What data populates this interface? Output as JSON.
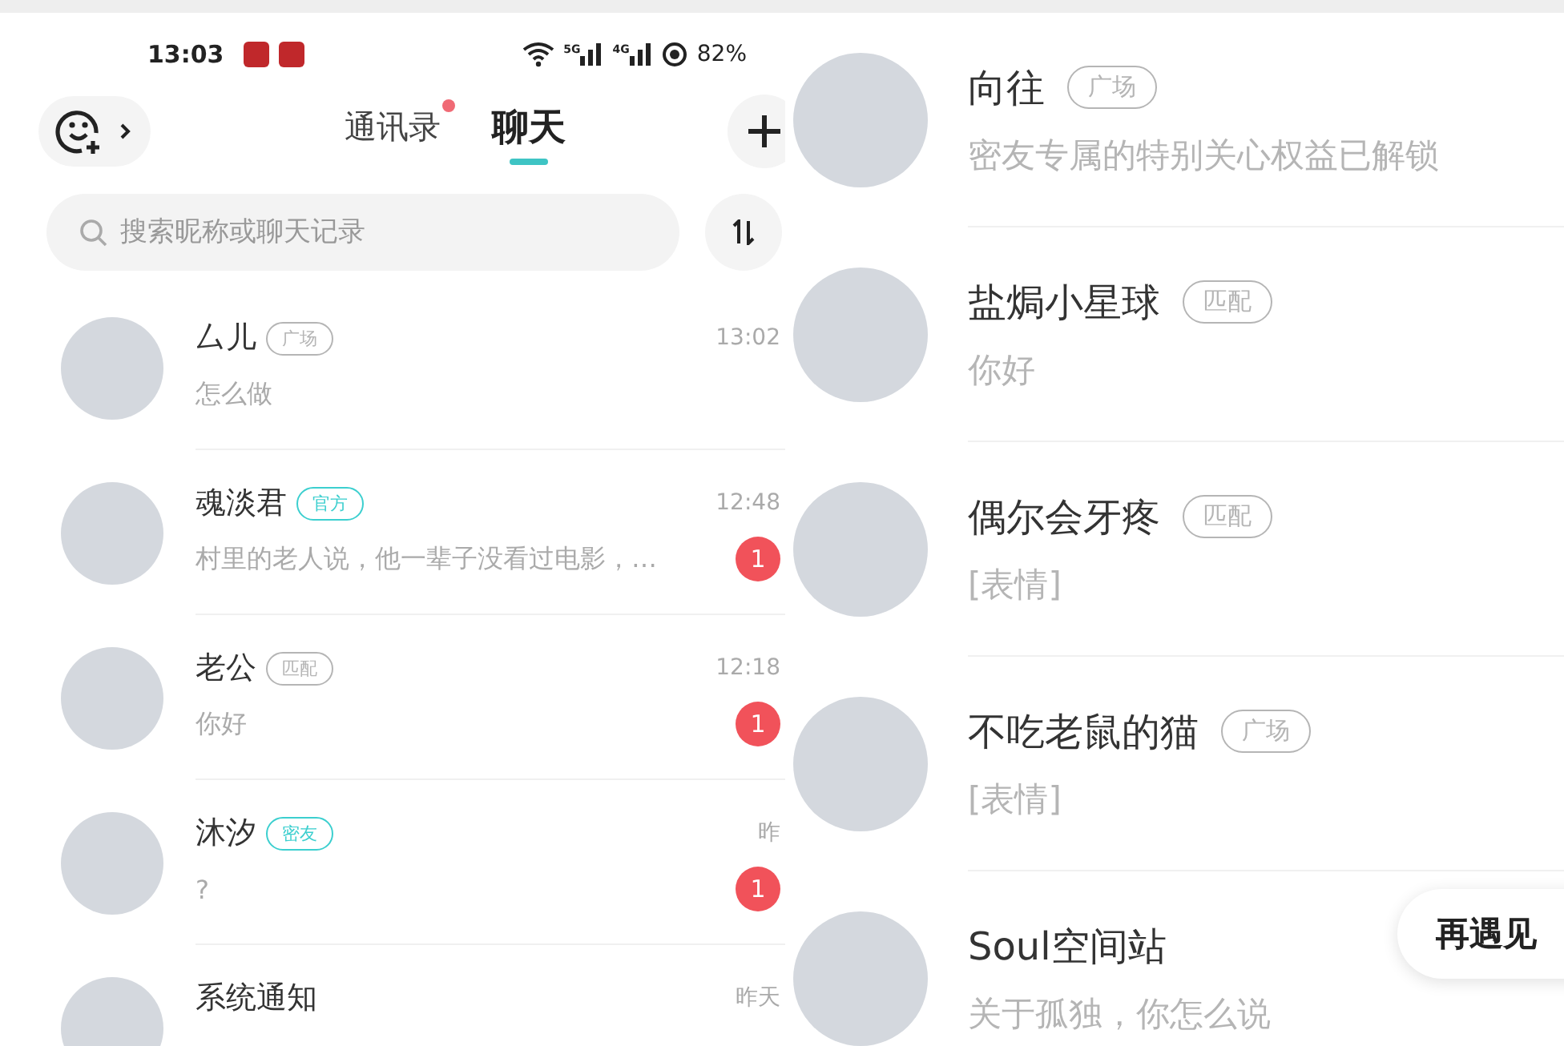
{
  "left_screen": {
    "status_bar": {
      "time": "13:03",
      "signal_labels": [
        "5G",
        "4G"
      ],
      "battery": "82%"
    },
    "tabs": [
      {
        "label": "通讯录",
        "selected": false,
        "dot": true
      },
      {
        "label": "聊天",
        "selected": true,
        "dot": false
      }
    ],
    "search": {
      "placeholder": "搜索昵称或聊天记录"
    },
    "chats": [
      {
        "name": "厶儿",
        "tag": {
          "label": "广场",
          "color": "#b5b5b5"
        },
        "preview": "怎么做",
        "time": "13:02"
      },
      {
        "name": "魂淡君",
        "tag": {
          "label": "官方",
          "color": "#3ccfcf"
        },
        "preview": "村里的老人说，他一辈子没看过电影，…",
        "time": "12:48",
        "badge": "1"
      },
      {
        "name": "老公",
        "tag": {
          "label": "匹配",
          "color": "#b5b5b5"
        },
        "preview": "你好",
        "time": "12:18",
        "badge": "1"
      },
      {
        "name": "沐汐",
        "tag": {
          "label": "密友",
          "color": "#3ccfcf"
        },
        "preview": "?",
        "time": "昨",
        "badge": "1"
      },
      {
        "name": "系统通知",
        "time": "昨天"
      }
    ]
  },
  "right_screen": {
    "chats": [
      {
        "name": "向往",
        "tag": {
          "label": "广场",
          "color": "#b5b5b5"
        },
        "preview": "密友专属的特别关心权益已解锁"
      },
      {
        "name": "盐焗小星球",
        "tag": {
          "label": "匹配",
          "color": "#b5b5b5"
        },
        "preview": "你好"
      },
      {
        "name": "偶尔会牙疼",
        "tag": {
          "label": "匹配",
          "color": "#b5b5b5"
        },
        "preview": "[表情]"
      },
      {
        "name": "不吃老鼠的猫",
        "tag": {
          "label": "广场",
          "color": "#b5b5b5"
        },
        "preview": "[表情]"
      },
      {
        "name": "Soul空间站",
        "preview": "关于孤独，你怎么说"
      }
    ],
    "floating_button": "再遇见"
  }
}
